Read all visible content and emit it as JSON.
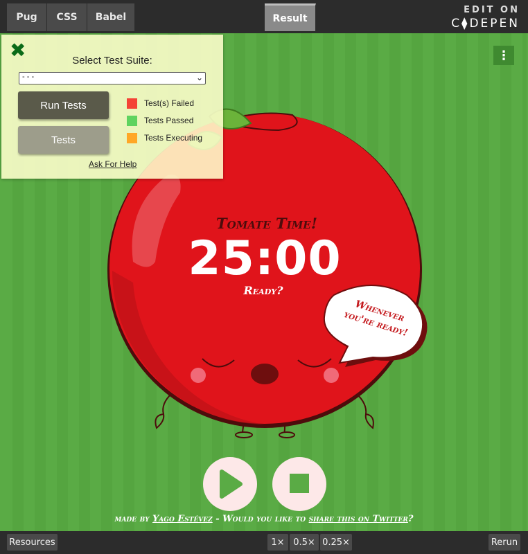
{
  "editor_tabs": [
    {
      "label": "Pug"
    },
    {
      "label": "CSS"
    },
    {
      "label": "Babel"
    }
  ],
  "result_tab": {
    "label": "Result"
  },
  "codepen_brand": {
    "edit_on": "EDIT ON",
    "name": "C⧫DEPEN"
  },
  "test_panel": {
    "close_symbol": "✖",
    "select_label": "Select Test Suite:",
    "select_value": "- - -",
    "run_tests_label": "Run Tests",
    "tests_label": "Tests",
    "legend": [
      {
        "label": "Test(s) Failed",
        "color": "#f44336"
      },
      {
        "label": "Tests Passed",
        "color": "#5fd35f"
      },
      {
        "label": "Tests Executing",
        "color": "#ffa726"
      }
    ],
    "help_link": "Ask For Help"
  },
  "menu_icon": "more-vertical-icon",
  "timer": {
    "title": "Tomate Time!",
    "time": "25:00",
    "status": "Ready?",
    "bubble": "Whenever you're ready!"
  },
  "controls": {
    "play_icon": "play-icon",
    "stop_icon": "stop-icon"
  },
  "footer": {
    "made_by": "made by",
    "author": "Yago Estévez",
    "dash": " - Would you like to",
    "share": "share this on Twitter",
    "question_mark": "?"
  },
  "bottom_bar": {
    "resources": "Resources",
    "zoom": [
      "1×",
      "0.5×",
      "0.25×"
    ],
    "rerun": "Rerun"
  },
  "colors": {
    "background": "#5aab45",
    "tomato": "#e0141b",
    "dark_red": "#6e0e0e",
    "leaf": "#6bb33a",
    "cheek": "#f06a78",
    "button_face": "#fde8e8"
  }
}
